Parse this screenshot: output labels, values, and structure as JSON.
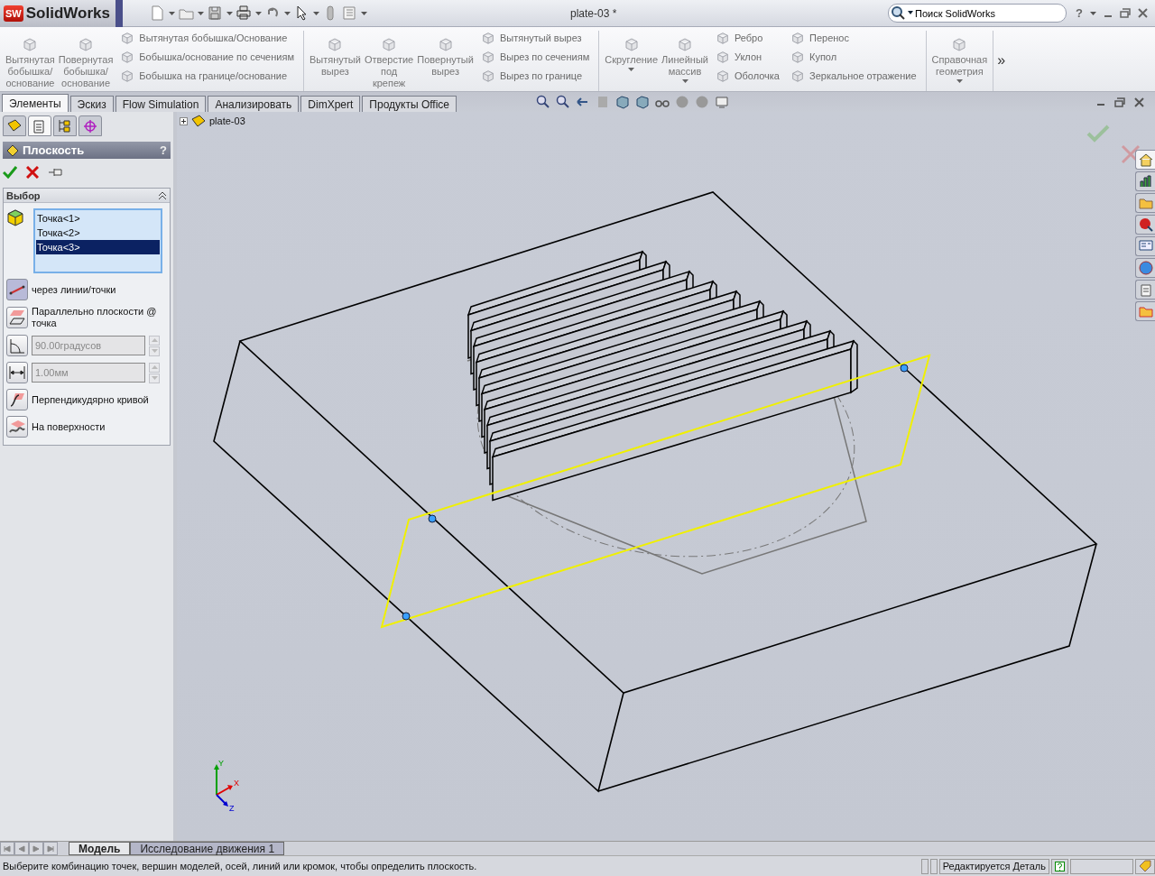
{
  "app": {
    "badge": "SW",
    "name": "SolidWorks"
  },
  "window": {
    "title": "plate-03 *",
    "help": "?"
  },
  "search": {
    "placeholder": "Поиск SolidWorks"
  },
  "ribbon": {
    "groups": [
      {
        "items": [
          {
            "kind": "large",
            "label": "Вытянутая бобышка/основание",
            "disabled": true,
            "dropdown": false
          },
          {
            "kind": "large",
            "label": "Повернутая бобышка/основание",
            "disabled": true,
            "dropdown": false
          },
          {
            "kind": "stack",
            "commands": [
              {
                "label": "Вытянутая бобышка/Основание",
                "disabled": true
              },
              {
                "label": "Бобышка/основание по сечениям",
                "disabled": true
              },
              {
                "label": "Бобышка на границе/основание",
                "disabled": true
              }
            ]
          }
        ]
      },
      {
        "items": [
          {
            "kind": "large",
            "label": "Вытянутый вырез",
            "disabled": true,
            "dropdown": false
          },
          {
            "kind": "large",
            "label": "Отверстие под крепеж",
            "disabled": true,
            "dropdown": false
          },
          {
            "kind": "large",
            "label": "Повернутый вырез",
            "disabled": true,
            "dropdown": false
          },
          {
            "kind": "stack",
            "commands": [
              {
                "label": "Вытянутый вырез",
                "disabled": true
              },
              {
                "label": "Вырез по сечениям",
                "disabled": true
              },
              {
                "label": "Вырез по границе",
                "disabled": true
              }
            ]
          }
        ]
      },
      {
        "items": [
          {
            "kind": "large",
            "label": "Скругление",
            "disabled": true,
            "dropdown": true
          },
          {
            "kind": "large",
            "label": "Линейный массив",
            "disabled": true,
            "dropdown": true
          },
          {
            "kind": "stack",
            "commands": [
              {
                "label": "Ребро",
                "disabled": true
              },
              {
                "label": "Уклон",
                "disabled": true
              },
              {
                "label": "Оболочка",
                "disabled": true
              }
            ]
          },
          {
            "kind": "stack",
            "commands": [
              {
                "label": "Перенос",
                "disabled": true
              },
              {
                "label": "Купол",
                "disabled": true
              },
              {
                "label": "Зеркальное отражение",
                "disabled": true
              }
            ]
          }
        ]
      },
      {
        "items": [
          {
            "kind": "large",
            "label": "Справочная геометрия",
            "disabled": true,
            "dropdown": true
          }
        ]
      }
    ],
    "more": "»"
  },
  "command_tabs": [
    {
      "label": "Элементы",
      "selected": true
    },
    {
      "label": "Эскиз",
      "selected": false
    },
    {
      "label": "Flow Simulation",
      "selected": false
    },
    {
      "label": "Анализировать",
      "selected": false
    },
    {
      "label": "DimXpert",
      "selected": false
    },
    {
      "label": "Продукты Office",
      "selected": false
    }
  ],
  "panel_tabs": [
    {
      "selected": false
    },
    {
      "selected": true
    },
    {
      "selected": false
    },
    {
      "selected": false
    }
  ],
  "property_manager": {
    "title": "Плоскость",
    "help": "?",
    "section": "Выбор",
    "selection": [
      {
        "label": "Точка<1>",
        "selected": false
      },
      {
        "label": "Точка<2>",
        "selected": false
      },
      {
        "label": "Точка<3>",
        "selected": true
      }
    ],
    "options": [
      {
        "kind": "toggle",
        "label": "через линии/точки",
        "selected": true
      },
      {
        "kind": "toggle",
        "label": "Параллельно плоскости @ точка",
        "selected": false
      },
      {
        "kind": "spin",
        "value": "90.00градусов",
        "disabled": true
      },
      {
        "kind": "spin",
        "value": "1.00мм",
        "disabled": true
      },
      {
        "kind": "toggle",
        "label": "Перпендикудярно кривой",
        "selected": false
      },
      {
        "kind": "toggle",
        "label": "На поверхности",
        "selected": false
      }
    ]
  },
  "tree": {
    "root": "plate-03",
    "expanded": false
  },
  "triad": [
    {
      "label": "Y",
      "color": "#00a000"
    },
    {
      "label": "X",
      "color": "#e00000"
    },
    {
      "label": "Z",
      "color": "#0000d0"
    }
  ],
  "bottom_tabs": [
    {
      "label": "Модель",
      "selected": true
    },
    {
      "label": "Исследование движения 1",
      "selected": false
    }
  ],
  "status": {
    "message": "Выберите комбинацию точек, вершин моделей, осей, линий или кромок, чтобы определить плоскость.",
    "mode": "Редактируется Деталь"
  }
}
